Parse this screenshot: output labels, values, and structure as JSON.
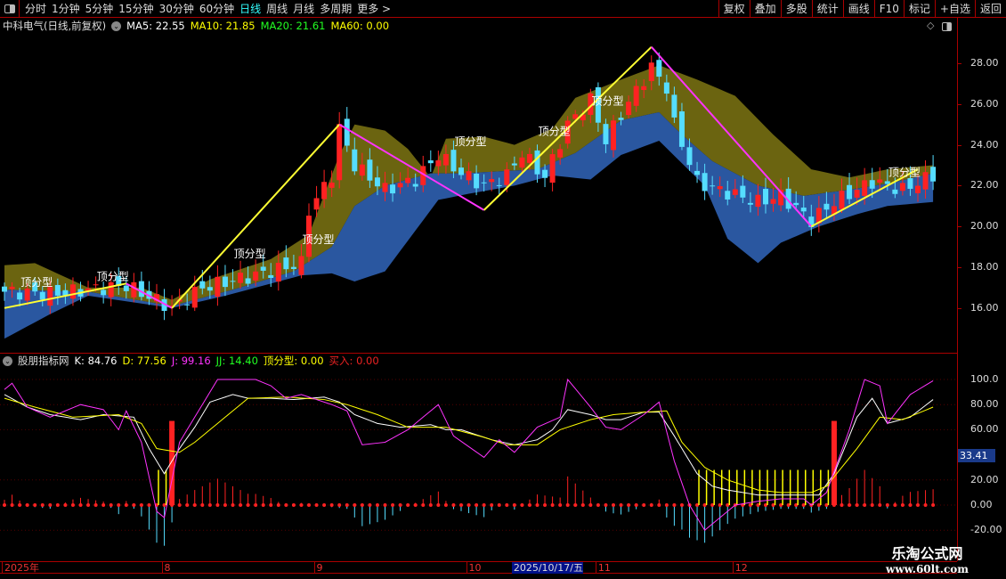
{
  "toolbar": {
    "periods": [
      "分时",
      "1分钟",
      "5分钟",
      "15分钟",
      "30分钟",
      "60分钟",
      "日线",
      "周线",
      "月线",
      "多周期",
      "更多 >"
    ],
    "active": "日线",
    "right_buttons": [
      "复权",
      "叠加",
      "多股",
      "统计",
      "画线",
      "F10",
      "标记",
      "+自选",
      "返回"
    ]
  },
  "main_legend": {
    "title": "中科电气(日线,前复权)",
    "ma5": "MA5: 22.55",
    "ma10": "MA10: 21.85",
    "ma20": "MA20: 21.61",
    "ma60": "MA60: 0.00"
  },
  "indicator_legend": {
    "name": "股朋指标网",
    "k": "K: 84.76",
    "d": "D: 77.56",
    "j": "J: 99.16",
    "jj": "JJ: 14.40",
    "dfx": "顶分型: 0.00",
    "buy": "买入: 0.00"
  },
  "price_axis": [
    "28.00",
    "26.00",
    "24.00",
    "22.00",
    "20.00",
    "18.00",
    "16.00"
  ],
  "indicator_axis": [
    "100.0",
    "80.00",
    "60.00",
    "20.00",
    "0.00",
    "-20.00"
  ],
  "current_value_badge": "33.41",
  "dates": [
    {
      "i": 0,
      "t": "2025年"
    },
    {
      "i": 21,
      "t": "8"
    },
    {
      "i": 41,
      "t": "9"
    },
    {
      "i": 61,
      "t": "10"
    },
    {
      "i": 67,
      "t": "2025/10/17/五",
      "hl": true
    },
    {
      "i": 78,
      "t": "11"
    },
    {
      "i": 96,
      "t": "12"
    }
  ],
  "pattern_label": "顶分型",
  "watermark": {
    "name": "乐淘公式网",
    "url": "www.60lt.com"
  },
  "colors": {
    "up": "#ff2222",
    "down": "#55ddff",
    "band_upper": "#6b6410",
    "band_lower": "#2a57a0",
    "zig_up": "#ffff33",
    "zig_down": "#ff33ff"
  },
  "chart_data": {
    "type": "candlestick",
    "bars": 123,
    "ylim": [
      14,
      29
    ],
    "close_keys": [
      [
        0,
        16.8
      ],
      [
        6,
        16.7
      ],
      [
        16,
        17.1
      ],
      [
        22,
        16.0
      ],
      [
        26,
        17.0
      ],
      [
        35,
        17.8
      ],
      [
        39,
        18.2
      ],
      [
        40,
        20.8
      ],
      [
        43,
        22.5
      ],
      [
        44,
        24.8
      ],
      [
        46,
        23.0
      ],
      [
        50,
        21.8
      ],
      [
        54,
        22.3
      ],
      [
        57,
        23.5
      ],
      [
        60,
        22.6
      ],
      [
        63,
        22.0
      ],
      [
        66,
        22.5
      ],
      [
        68,
        23.6
      ],
      [
        71,
        22.4
      ],
      [
        74,
        25.0
      ],
      [
        77,
        26.2
      ],
      [
        79,
        24.2
      ],
      [
        81,
        25.5
      ],
      [
        85,
        27.8
      ],
      [
        87,
        26.8
      ],
      [
        88,
        25.0
      ],
      [
        91,
        22.2
      ],
      [
        93,
        21.9
      ],
      [
        99,
        21.2
      ],
      [
        102,
        21.5
      ],
      [
        106,
        20.3
      ],
      [
        109,
        21.2
      ],
      [
        114,
        22.2
      ],
      [
        118,
        21.8
      ],
      [
        122,
        22.5
      ]
    ],
    "band_top": [
      [
        0,
        18.1
      ],
      [
        4,
        18.2
      ],
      [
        11,
        17.0
      ],
      [
        18,
        17.0
      ],
      [
        22,
        16.4
      ],
      [
        27,
        17.4
      ],
      [
        35,
        18.4
      ],
      [
        40,
        19.6
      ],
      [
        44,
        23.5
      ],
      [
        46,
        25.0
      ],
      [
        50,
        24.7
      ],
      [
        53,
        23.8
      ],
      [
        56,
        22.4
      ],
      [
        58,
        24.3
      ],
      [
        63,
        24.4
      ],
      [
        67,
        24.0
      ],
      [
        72,
        24.8
      ],
      [
        75,
        26.3
      ],
      [
        81,
        27.2
      ],
      [
        86,
        27.9
      ],
      [
        91,
        27.2
      ],
      [
        96,
        26.4
      ],
      [
        101,
        24.5
      ],
      [
        106,
        22.8
      ],
      [
        111,
        22.4
      ],
      [
        116,
        22.8
      ],
      [
        122,
        23.0
      ]
    ],
    "band_mid": [
      [
        0,
        16.9
      ],
      [
        11,
        16.8
      ],
      [
        22,
        16.1
      ],
      [
        30,
        16.9
      ],
      [
        38,
        17.8
      ],
      [
        43,
        19.0
      ],
      [
        46,
        21.0
      ],
      [
        50,
        22.0
      ],
      [
        56,
        22.6
      ],
      [
        60,
        22.6
      ],
      [
        70,
        22.8
      ],
      [
        75,
        23.6
      ],
      [
        81,
        25.2
      ],
      [
        86,
        25.6
      ],
      [
        89,
        24.5
      ],
      [
        93,
        23.2
      ],
      [
        99,
        22.0
      ],
      [
        105,
        21.5
      ],
      [
        111,
        21.8
      ],
      [
        116,
        22.1
      ],
      [
        122,
        22.6
      ]
    ],
    "band_bottom": [
      [
        0,
        14.5
      ],
      [
        6,
        15.7
      ],
      [
        11,
        16.6
      ],
      [
        22,
        16.0
      ],
      [
        29,
        16.6
      ],
      [
        35,
        17.2
      ],
      [
        39,
        17.6
      ],
      [
        43,
        17.7
      ],
      [
        46,
        17.3
      ],
      [
        50,
        17.8
      ],
      [
        54,
        19.8
      ],
      [
        57,
        21.3
      ],
      [
        61,
        21.6
      ],
      [
        67,
        22.0
      ],
      [
        72,
        22.5
      ],
      [
        77,
        22.3
      ],
      [
        81,
        23.5
      ],
      [
        86,
        24.2
      ],
      [
        92,
        22.0
      ],
      [
        95,
        19.4
      ],
      [
        99,
        18.2
      ],
      [
        102,
        19.2
      ],
      [
        107,
        20.0
      ],
      [
        112,
        20.6
      ],
      [
        116,
        21.0
      ],
      [
        122,
        21.2
      ]
    ],
    "zigzag": [
      [
        0,
        16.0
      ],
      [
        16,
        17.2
      ],
      [
        22,
        16.0
      ],
      [
        44,
        25.0
      ],
      [
        63,
        20.8
      ],
      [
        85,
        28.8
      ],
      [
        106,
        20.0
      ],
      [
        120,
        22.8
      ]
    ],
    "pattern_marks": [
      [
        4,
        16.9
      ],
      [
        14,
        17.2
      ],
      [
        32,
        18.3
      ],
      [
        41,
        19.0
      ],
      [
        61,
        23.8
      ],
      [
        72,
        24.3
      ],
      [
        79,
        25.8
      ],
      [
        118,
        22.3
      ]
    ],
    "indicator": {
      "ylim": [
        -30,
        105
      ],
      "K": [
        [
          0,
          88
        ],
        [
          3,
          78
        ],
        [
          6,
          72
        ],
        [
          10,
          68
        ],
        [
          13,
          72
        ],
        [
          17,
          70
        ],
        [
          19,
          45
        ],
        [
          21,
          25
        ],
        [
          23,
          45
        ],
        [
          25,
          62
        ],
        [
          27,
          82
        ],
        [
          30,
          88
        ],
        [
          32,
          85
        ],
        [
          35,
          85
        ],
        [
          38,
          84
        ],
        [
          42,
          86
        ],
        [
          44,
          82
        ],
        [
          46,
          72
        ],
        [
          49,
          65
        ],
        [
          52,
          62
        ],
        [
          56,
          64
        ],
        [
          58,
          60
        ],
        [
          60,
          60
        ],
        [
          64,
          52
        ],
        [
          67,
          48
        ],
        [
          70,
          52
        ],
        [
          72,
          60
        ],
        [
          74,
          76
        ],
        [
          77,
          72
        ],
        [
          79,
          68
        ],
        [
          81,
          68
        ],
        [
          84,
          74
        ],
        [
          86,
          74
        ],
        [
          88,
          55
        ],
        [
          91,
          25
        ],
        [
          93,
          15
        ],
        [
          95,
          12
        ],
        [
          99,
          8
        ],
        [
          105,
          8
        ],
        [
          107,
          8
        ],
        [
          109,
          25
        ],
        [
          112,
          70
        ],
        [
          114,
          85
        ],
        [
          116,
          65
        ],
        [
          119,
          70
        ],
        [
          122,
          84
        ]
      ],
      "D": [
        [
          0,
          85
        ],
        [
          4,
          78
        ],
        [
          9,
          70
        ],
        [
          15,
          72
        ],
        [
          18,
          65
        ],
        [
          20,
          45
        ],
        [
          23,
          42
        ],
        [
          25,
          50
        ],
        [
          29,
          70
        ],
        [
          32,
          85
        ],
        [
          37,
          86
        ],
        [
          42,
          84
        ],
        [
          45,
          80
        ],
        [
          49,
          72
        ],
        [
          53,
          62
        ],
        [
          58,
          62
        ],
        [
          63,
          54
        ],
        [
          66,
          48
        ],
        [
          70,
          48
        ],
        [
          73,
          60
        ],
        [
          77,
          68
        ],
        [
          80,
          72
        ],
        [
          84,
          74
        ],
        [
          87,
          75
        ],
        [
          89,
          50
        ],
        [
          92,
          30
        ],
        [
          95,
          20
        ],
        [
          99,
          12
        ],
        [
          102,
          10
        ],
        [
          106,
          10
        ],
        [
          108,
          15
        ],
        [
          112,
          45
        ],
        [
          115,
          70
        ],
        [
          118,
          68
        ],
        [
          122,
          78
        ]
      ],
      "J": [
        [
          0,
          92
        ],
        [
          1,
          97
        ],
        [
          3,
          78
        ],
        [
          6,
          70
        ],
        [
          10,
          80
        ],
        [
          13,
          76
        ],
        [
          15,
          60
        ],
        [
          16,
          75
        ],
        [
          18,
          50
        ],
        [
          20,
          -5
        ],
        [
          21,
          -10
        ],
        [
          23,
          50
        ],
        [
          26,
          80
        ],
        [
          28,
          100
        ],
        [
          30,
          100
        ],
        [
          33,
          100
        ],
        [
          35,
          95
        ],
        [
          37,
          85
        ],
        [
          39,
          88
        ],
        [
          43,
          80
        ],
        [
          45,
          75
        ],
        [
          47,
          48
        ],
        [
          50,
          50
        ],
        [
          53,
          60
        ],
        [
          57,
          80
        ],
        [
          59,
          55
        ],
        [
          63,
          38
        ],
        [
          65,
          52
        ],
        [
          67,
          42
        ],
        [
          70,
          62
        ],
        [
          73,
          70
        ],
        [
          74,
          100
        ],
        [
          77,
          78
        ],
        [
          79,
          62
        ],
        [
          81,
          60
        ],
        [
          84,
          72
        ],
        [
          86,
          82
        ],
        [
          88,
          35
        ],
        [
          90,
          0
        ],
        [
          92,
          -20
        ],
        [
          94,
          -10
        ],
        [
          96,
          0
        ],
        [
          99,
          3
        ],
        [
          102,
          5
        ],
        [
          105,
          5
        ],
        [
          106,
          0
        ],
        [
          108,
          10
        ],
        [
          111,
          60
        ],
        [
          113,
          100
        ],
        [
          115,
          95
        ],
        [
          116,
          65
        ],
        [
          119,
          88
        ],
        [
          122,
          99
        ]
      ],
      "buy_signals": [
        22,
        109
      ],
      "yellow_zone": [
        [
          20,
          21
        ],
        [
          91,
          109
        ]
      ]
    }
  }
}
